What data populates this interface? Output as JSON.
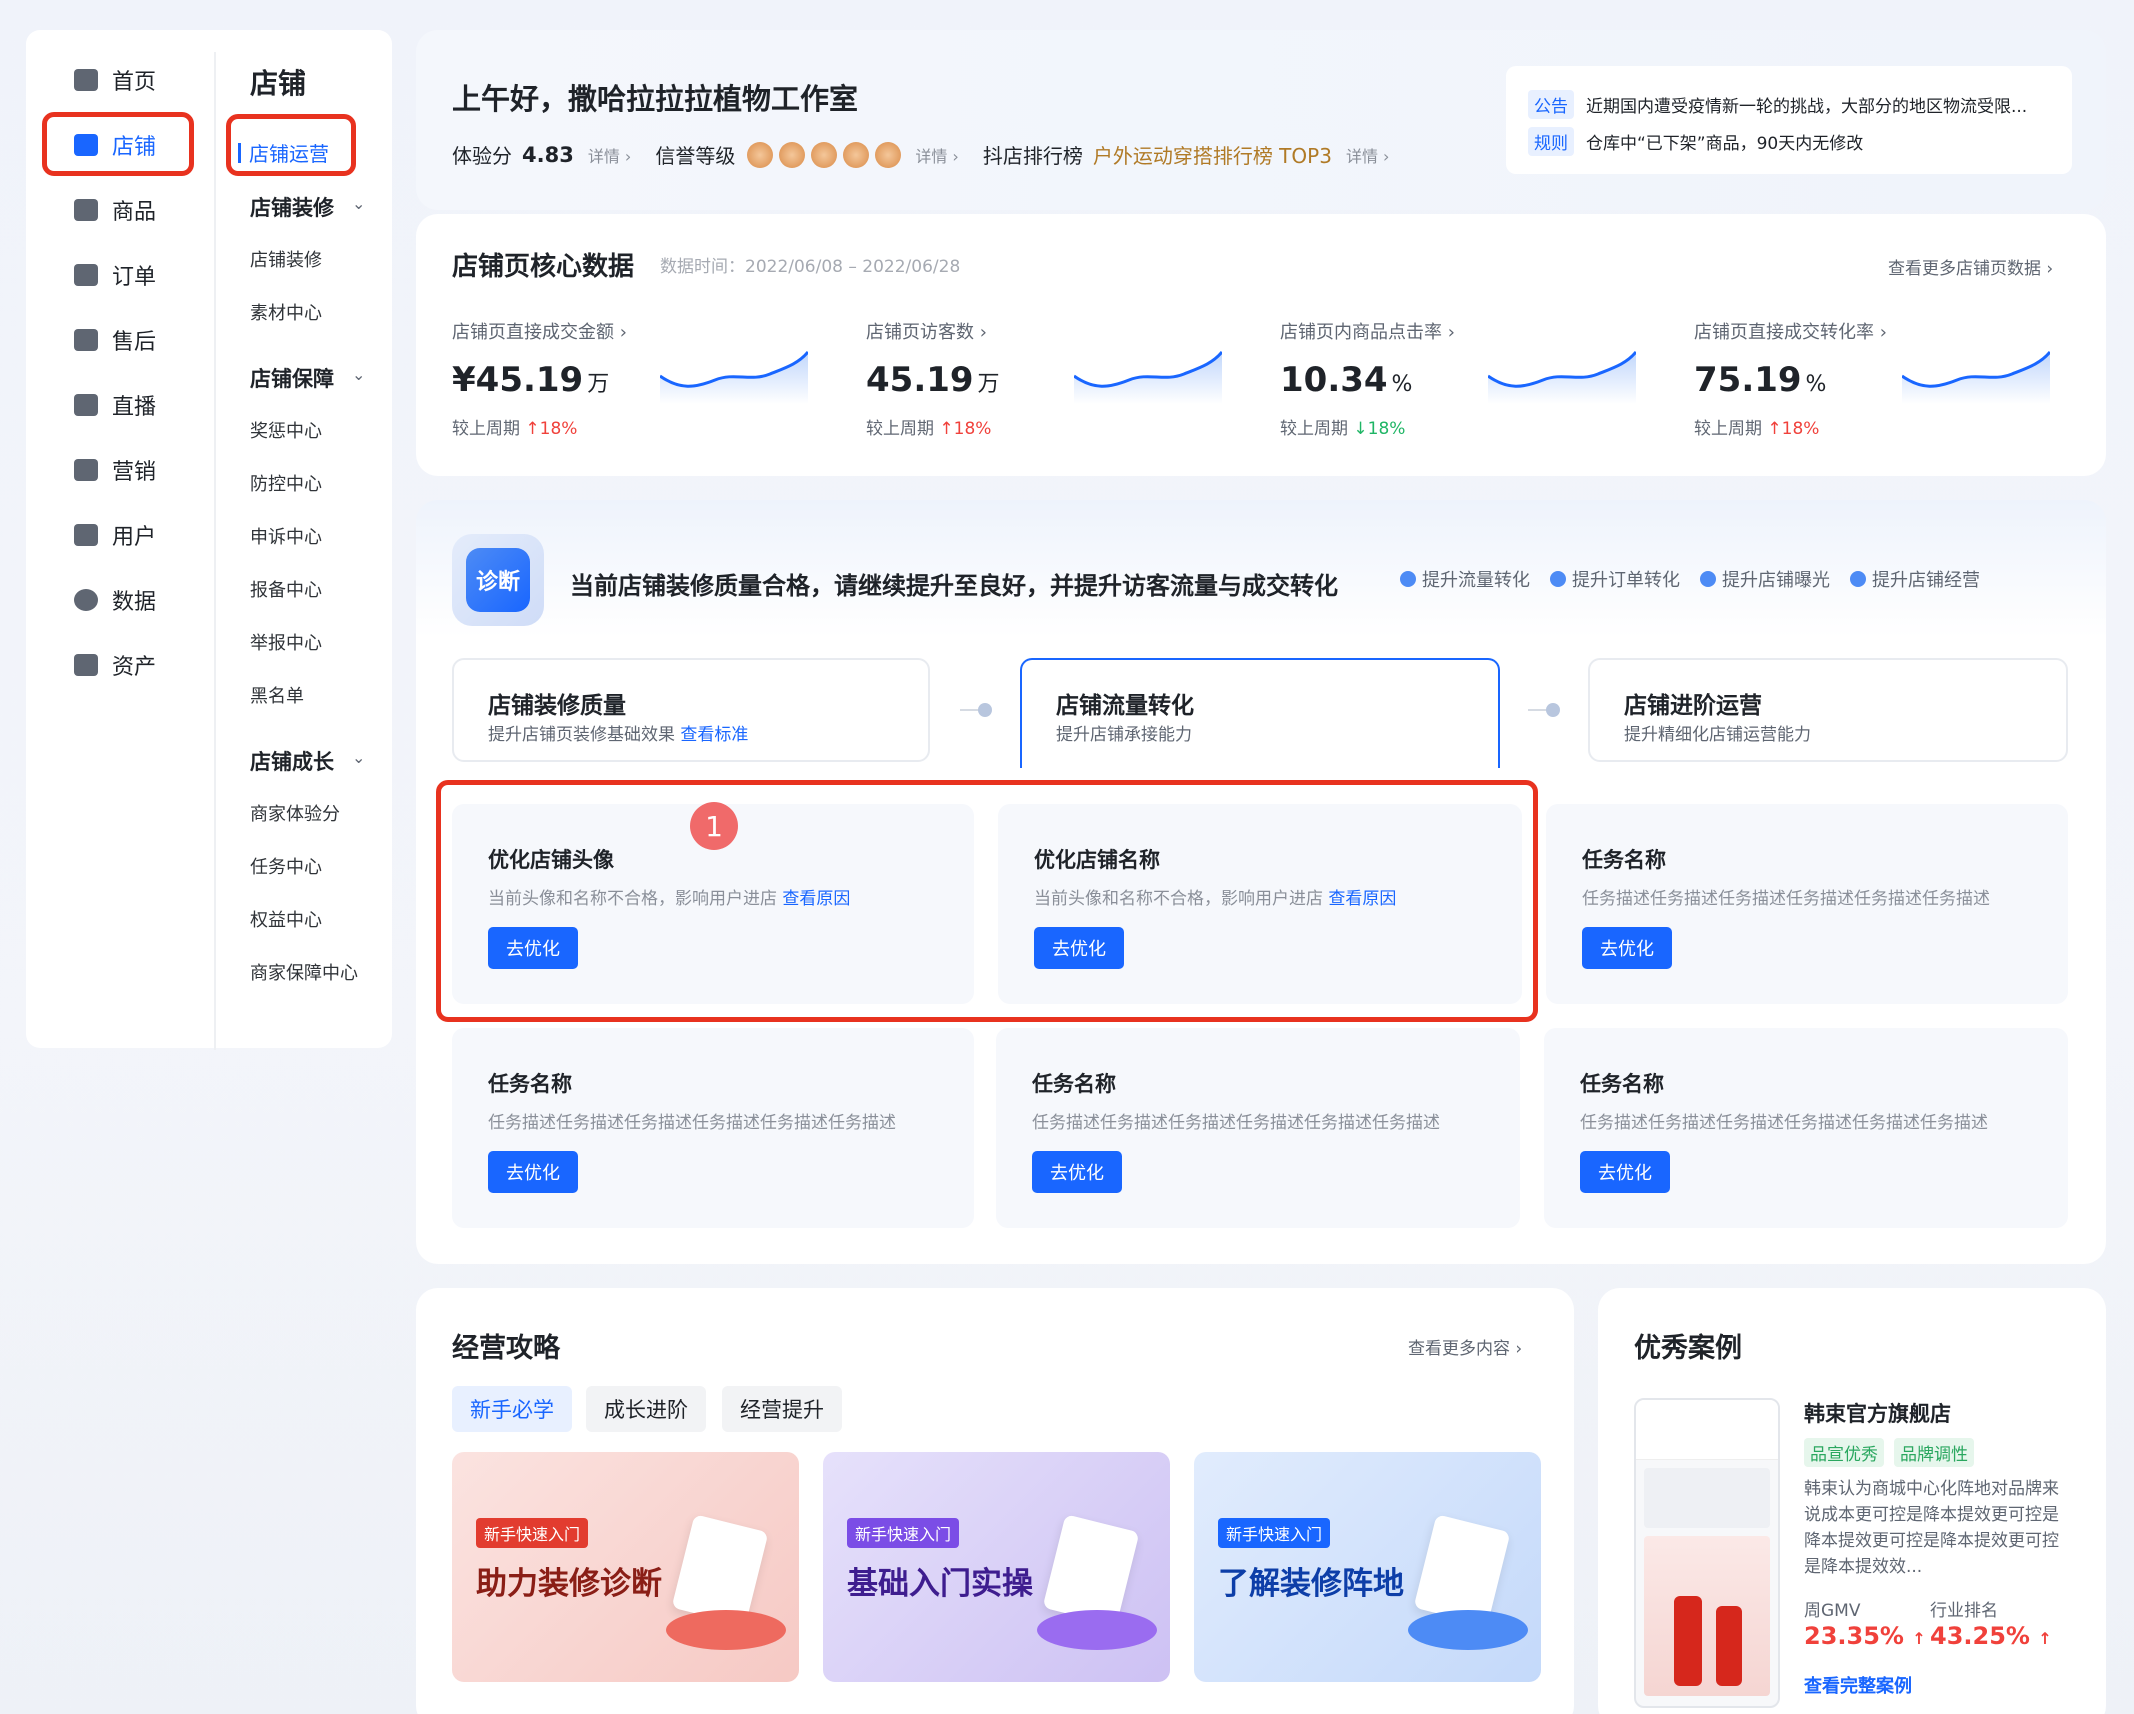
{
  "nav": {
    "items": [
      {
        "label": "首页",
        "icon": "home-icon"
      },
      {
        "label": "店铺",
        "icon": "store-icon",
        "active": true
      },
      {
        "label": "商品",
        "icon": "goods-icon"
      },
      {
        "label": "订单",
        "icon": "order-icon"
      },
      {
        "label": "售后",
        "icon": "after-sale-icon"
      },
      {
        "label": "直播",
        "icon": "live-icon"
      },
      {
        "label": "营销",
        "icon": "megaphone-icon"
      },
      {
        "label": "用户",
        "icon": "user-icon"
      },
      {
        "label": "数据",
        "icon": "pie-chart-icon"
      },
      {
        "label": "资产",
        "icon": "wallet-icon"
      }
    ]
  },
  "subnav": {
    "title": "店铺",
    "active": "店铺运营",
    "group1": "店铺装修",
    "g1items": [
      "店铺装修",
      "素材中心"
    ],
    "group2": "店铺保障",
    "g2items": [
      "奖惩中心",
      "防控中心",
      "申诉中心",
      "报备中心",
      "举报中心",
      "黑名单"
    ],
    "group3": "店铺成长",
    "g3items": [
      "商家体验分",
      "任务中心",
      "权益中心",
      "商家保障中心"
    ]
  },
  "header": {
    "greeting": "上午好，撒哈拉拉拉植物工作室",
    "score_label": "体验分",
    "score": "4.83",
    "detail": "详情 ›",
    "credit_label": "信誉等级",
    "rank_label": "抖店排行榜",
    "rank_value": "户外运动穿搭排行榜 TOP3",
    "notice_tag": "公告",
    "notice_text": "近期国内遭受疫情新一轮的挑战，大部分的地区物流受限...",
    "rule_tag": "规则",
    "rule_text": "仓库中“已下架”商品，90天内无修改"
  },
  "core": {
    "title": "店铺页核心数据",
    "date": "数据时间：2022/06/08 – 2022/06/28",
    "more": "查看更多店铺页数据 ›",
    "compare": "较上周期",
    "metrics": [
      {
        "label": "店铺页直接成交金额 ›",
        "value": "¥45.19",
        "unit": "万",
        "delta": "18%",
        "dir": "up",
        "arrow": "↑"
      },
      {
        "label": "店铺页访客数 ›",
        "value": "45.19",
        "unit": "万",
        "delta": "18%",
        "dir": "up",
        "arrow": "↑"
      },
      {
        "label": "店铺页内商品点击率 ›",
        "value": "10.34",
        "unit": "%",
        "delta": "18%",
        "dir": "down",
        "arrow": "↓"
      },
      {
        "label": "店铺页直接成交转化率 ›",
        "value": "75.19",
        "unit": "%",
        "delta": "18%",
        "dir": "up",
        "arrow": "↑"
      }
    ]
  },
  "diag": {
    "badge": "诊断",
    "text": "当前店铺装修质量合格，请继续提升至良好，并提升访客流量与成交转化",
    "chips": [
      "提升流量转化",
      "提升订单转化",
      "提升店铺曝光",
      "提升店铺经营"
    ],
    "steps": [
      {
        "title": "店铺装修质量",
        "desc": "提升店铺页装修基础效果 ",
        "link": "查看标准"
      },
      {
        "title": "店铺流量转化",
        "desc": "提升店铺承接能力"
      },
      {
        "title": "店铺进阶运营",
        "desc": "提升精细化店铺运营能力"
      }
    ],
    "marker": "1",
    "btn": "去优化",
    "tasks": [
      {
        "title": "优化店铺头像",
        "desc": "当前头像和名称不合格，影响用户进店 ",
        "link": "查看原因"
      },
      {
        "title": "优化店铺名称",
        "desc": "当前头像和名称不合格，影响用户进店 ",
        "link": "查看原因"
      },
      {
        "title": "任务名称",
        "desc": "任务描述任务描述任务描述任务描述任务描述任务描述",
        "link": ""
      },
      {
        "title": "任务名称",
        "desc": "任务描述任务描述任务描述任务描述任务描述任务描述",
        "link": ""
      },
      {
        "title": "任务名称",
        "desc": "任务描述任务描述任务描述任务描述任务描述任务描述",
        "link": ""
      },
      {
        "title": "任务名称",
        "desc": "任务描述任务描述任务描述任务描述任务描述任务描述",
        "link": ""
      }
    ]
  },
  "guide": {
    "title": "经营攻略",
    "more": "查看更多内容 ›",
    "tabs": [
      "新手必学",
      "成长进阶",
      "经营提升"
    ],
    "banners": [
      {
        "tag": "新手快速入门",
        "title": "助力装修诊断"
      },
      {
        "tag": "新手快速入门",
        "title": "基础入门实操"
      },
      {
        "tag": "新手快速入门",
        "title": "了解装修阵地"
      }
    ]
  },
  "case": {
    "title": "优秀案例",
    "shop": "韩束官方旗舰店",
    "tags": [
      "品宣优秀",
      "品牌调性"
    ],
    "desc": "韩束认为商城中心化阵地对品牌来说成本更可控是降本提效更可控是降本提效更可控是降本提效更可控是降本提效效...",
    "gmv_label": "周GMV",
    "gmv": "23.35%",
    "rank_label": "行业排名",
    "rank": "43.25%",
    "up": "↑",
    "link": "查看完整案例"
  }
}
